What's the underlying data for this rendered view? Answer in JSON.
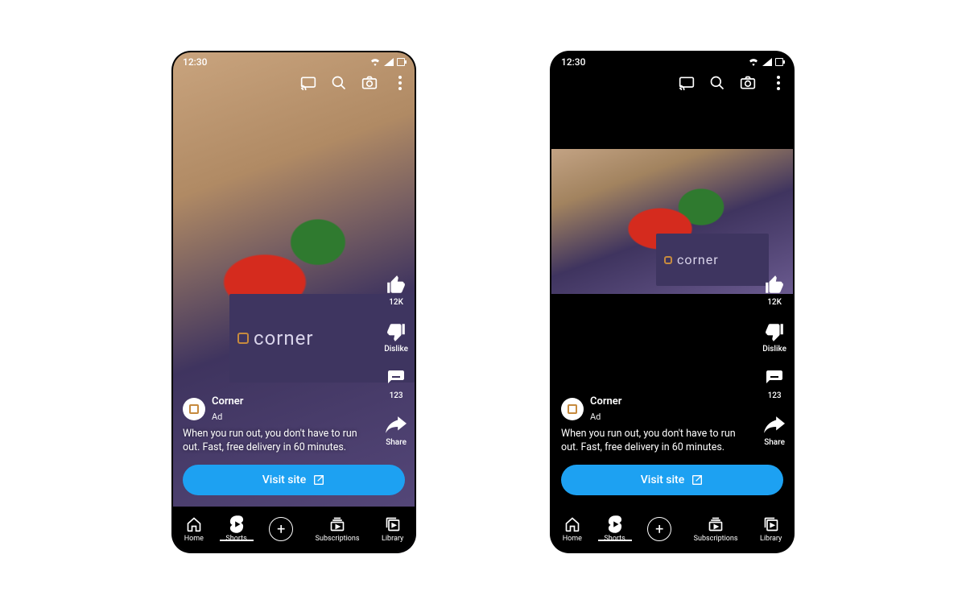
{
  "status": {
    "time": "12:30"
  },
  "top_icons": {
    "cast": "cast-icon",
    "search": "search-icon",
    "camera": "camera-icon",
    "more": "more-icon"
  },
  "advertiser": {
    "name": "Corner",
    "badge": "Ad",
    "brand_word": "corner"
  },
  "caption": "When you run out, you don't have to run out. Fast, free delivery in 60 minutes.",
  "cta_label": "Visit site",
  "rail": {
    "like": {
      "label": "12K"
    },
    "dislike": {
      "label": "Dislike"
    },
    "comment": {
      "label": "123"
    },
    "share": {
      "label": "Share"
    }
  },
  "nav": {
    "home": {
      "label": "Home"
    },
    "shorts": {
      "label": "Shorts"
    },
    "subs": {
      "label": "Subscriptions"
    },
    "library": {
      "label": "Library"
    }
  }
}
